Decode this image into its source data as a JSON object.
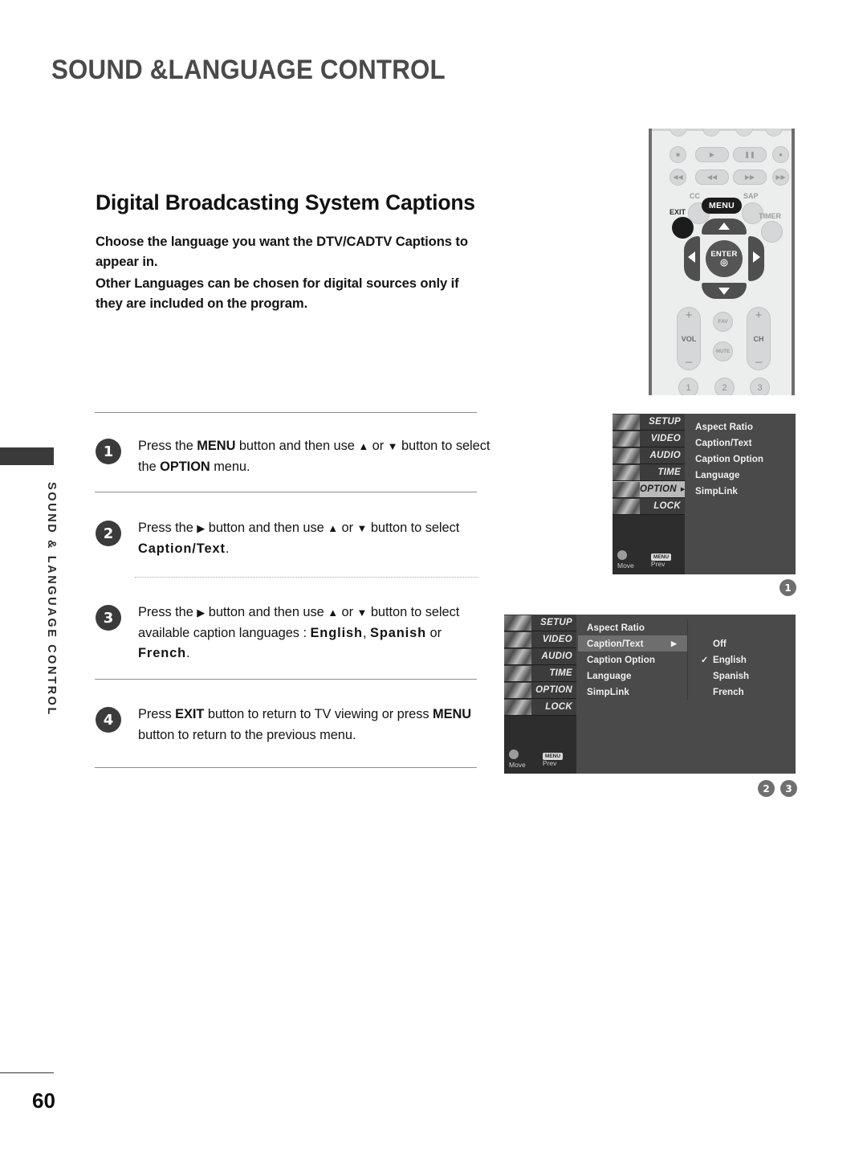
{
  "header": {
    "title": "SOUND &LANGUAGE CONTROL"
  },
  "side_tab": {
    "label": "SOUND & LANGUAGE CONTROL"
  },
  "section": {
    "heading": "Digital Broadcasting System Captions",
    "intro_1": "Choose the language you want the DTV/CADTV Captions to appear in.",
    "intro_2": "Other Languages can be chosen for digital sources only if they are included on the program."
  },
  "steps": [
    {
      "num": "1",
      "text_html": "Press the <b>MENU</b> button and then use <span class=\"arrowg\">▲</span> or <span class=\"arrowg\">▼</span> button to select the <b>OPTION</b> menu."
    },
    {
      "num": "2",
      "text_html": "Press the <span class=\"arrowg\">▶</span> button and then use <span class=\"arrowg\">▲</span> or <span class=\"arrowg\">▼</span> button to select <span class=\"sp\">Caption/Text</span>."
    },
    {
      "num": "3",
      "text_html": "Press the <span class=\"arrowg\">▶</span> button and then use <span class=\"arrowg\">▲</span> or <span class=\"arrowg\">▼</span> button to select available caption languages : <span class=\"sp\">English</span>, <span class=\"sp\">Spanish</span> or <span class=\"sp\">French</span>."
    },
    {
      "num": "4",
      "text_html": "Press <b>EXIT</b> button to return to TV viewing or press <b>MENU</b> button to return to the previous menu."
    }
  ],
  "remote": {
    "labels": {
      "cc": "CC",
      "menu": "MENU",
      "sap": "SAP",
      "exit": "EXIT",
      "timer": "TIMER",
      "enter": "ENTER",
      "vol": "VOL",
      "ch": "CH",
      "fav": "FAV",
      "mute": "MUTE"
    },
    "numbers": [
      "1",
      "2",
      "3"
    ]
  },
  "osd1": {
    "menu": [
      {
        "label": "SETUP",
        "selected": false
      },
      {
        "label": "VIDEO",
        "selected": false
      },
      {
        "label": "AUDIO",
        "selected": false
      },
      {
        "label": "TIME",
        "selected": false
      },
      {
        "label": "OPTION",
        "selected": true
      },
      {
        "label": "LOCK",
        "selected": false
      }
    ],
    "items": [
      {
        "label": "Aspect Ratio",
        "highlight": false
      },
      {
        "label": "Caption/Text",
        "highlight": false
      },
      {
        "label": "Caption Option",
        "highlight": false
      },
      {
        "label": "Language",
        "highlight": false
      },
      {
        "label": "SimpLink",
        "highlight": false
      }
    ],
    "hints": {
      "move": "Move",
      "prev": "Prev",
      "prev_key": "MENU"
    },
    "marker": "1"
  },
  "osd2": {
    "menu": [
      {
        "label": "SETUP",
        "selected": false
      },
      {
        "label": "VIDEO",
        "selected": false
      },
      {
        "label": "AUDIO",
        "selected": false
      },
      {
        "label": "TIME",
        "selected": false
      },
      {
        "label": "OPTION",
        "selected": false
      },
      {
        "label": "LOCK",
        "selected": false
      }
    ],
    "items": [
      {
        "label": "Aspect Ratio",
        "highlight": false
      },
      {
        "label": "Caption/Text",
        "highlight": true
      },
      {
        "label": "Caption Option",
        "highlight": false
      },
      {
        "label": "Language",
        "highlight": false
      },
      {
        "label": "SimpLink",
        "highlight": false
      }
    ],
    "submenu": [
      {
        "label": "Off",
        "checked": false
      },
      {
        "label": "English",
        "checked": true
      },
      {
        "label": "Spanish",
        "checked": false
      },
      {
        "label": "French",
        "checked": false
      }
    ],
    "hints": {
      "move": "Move",
      "prev": "Prev",
      "prev_key": "MENU"
    },
    "markers": [
      "2",
      "3"
    ]
  },
  "footer": {
    "page_number": "60"
  },
  "colors": {
    "title": "#4a4a4a",
    "osd_background": "#4a4a4a",
    "osd_sidebar": "#2d2d2d",
    "osd_highlight": "#6e6e6e",
    "osd_selected_row": "#b9b9b9",
    "marker": "#6f6f6f",
    "step_circle": "#3b3b3b"
  }
}
